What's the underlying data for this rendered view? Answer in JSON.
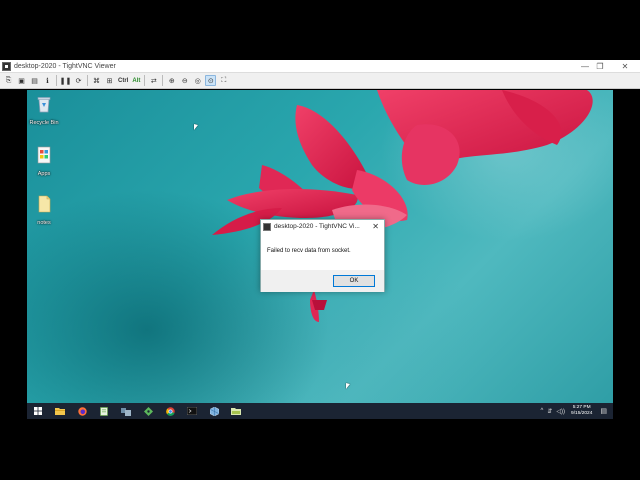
{
  "window": {
    "title": "desktop-2020 - TightVNC Viewer",
    "controls": {
      "minimize": "—",
      "maximize": "❐",
      "close": "✕"
    }
  },
  "toolbar": {
    "buttons": [
      {
        "name": "new-connection-icon",
        "glyph": "⎘"
      },
      {
        "name": "save-icon",
        "glyph": "▣"
      },
      {
        "name": "options-icon",
        "glyph": "▤"
      },
      {
        "name": "info-icon",
        "glyph": "ℹ"
      },
      {
        "name": "pause-icon",
        "glyph": "❚❚"
      },
      {
        "name": "refresh-icon",
        "glyph": "⟳"
      },
      {
        "name": "ctrl-alt-del-icon",
        "glyph": "⌘"
      },
      {
        "name": "start-menu-icon",
        "glyph": "⊞"
      },
      {
        "name": "transfer-files-icon",
        "glyph": "⇄"
      },
      {
        "name": "zoom-in-icon",
        "glyph": "⊕"
      },
      {
        "name": "zoom-out-icon",
        "glyph": "⊖"
      },
      {
        "name": "zoom-100-icon",
        "glyph": "◎"
      },
      {
        "name": "zoom-fit-icon",
        "glyph": "⊙"
      },
      {
        "name": "fullscreen-icon",
        "glyph": "⛶"
      }
    ],
    "ctrl_label": "Ctrl",
    "alt_label": "Alt"
  },
  "desktop_icons": [
    {
      "label": "Recycle Bin",
      "icon": "recycle-bin-icon"
    },
    {
      "label": "Apps",
      "icon": "apps-icon"
    },
    {
      "label": "notes",
      "icon": "folder-icon"
    }
  ],
  "dialog": {
    "title": "desktop-2020 - TightVNC Vi...",
    "message": "Failed to recv data from socket.",
    "ok_label": "OK",
    "close_glyph": "✕"
  },
  "taskbar": {
    "apps": [
      "start-icon",
      "file-explorer-icon",
      "firefox-icon",
      "notepad-icon",
      "network-tool-icon",
      "git-icon",
      "chrome-icon",
      "terminal-icon",
      "virtualbox-icon",
      "editor-icon"
    ],
    "tray_glyphs": {
      "chevron": "^",
      "network": "⇵",
      "speaker": "◁))"
    },
    "time": "5:27 PM",
    "date": "9/15/2024",
    "notification_glyph": "▤"
  },
  "colors": {
    "accent": "#0078d7",
    "taskbar": "#1b2433",
    "petal": "#e8285a"
  }
}
